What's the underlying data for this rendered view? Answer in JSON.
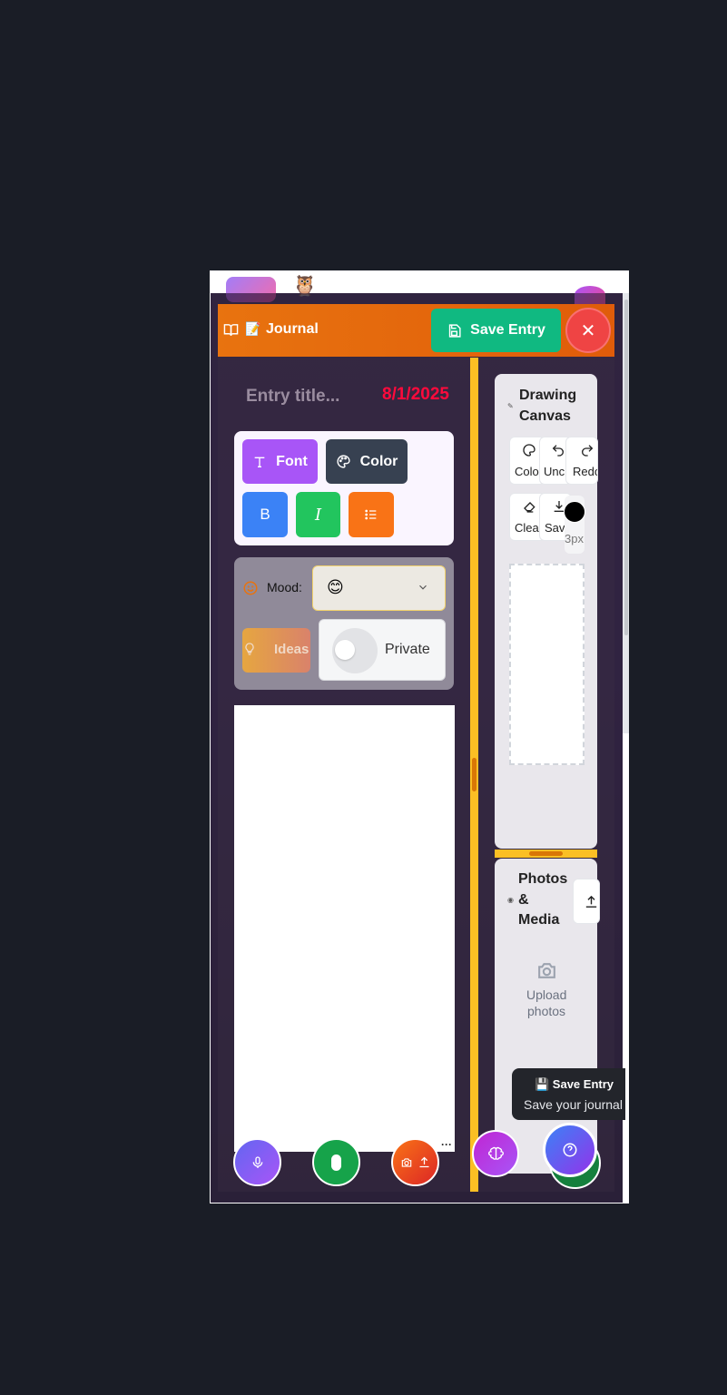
{
  "header": {
    "title": "Journal",
    "save_label": "Save Entry",
    "close_symbol": "✕",
    "colors": {
      "start": "#e8730f",
      "end": "#e05c0a"
    }
  },
  "entry": {
    "title_placeholder": "Entry title...",
    "date": "8/1/2025"
  },
  "toolbar": {
    "font_label": "Font",
    "color_label": "Color",
    "bold_icon": "B",
    "italic_icon": "I"
  },
  "mood": {
    "label": "Mood:",
    "selected": "😊"
  },
  "ideas": {
    "label": "Ideas"
  },
  "privacy": {
    "label": "Private",
    "enabled": false
  },
  "drawing": {
    "title_line1": "Drawing",
    "title_line2": "Canvas",
    "tools": [
      {
        "label": "Colo",
        "icon": "palette-icon"
      },
      {
        "label": "Unc",
        "icon": "undo-icon"
      },
      {
        "label": "Redo",
        "icon": "redo-icon"
      },
      {
        "label": "Clea",
        "icon": "eraser-icon"
      },
      {
        "label": "Sav",
        "icon": "download-icon"
      }
    ],
    "brush_size": "3px"
  },
  "photos": {
    "title_line1": "Photos",
    "title_line2": "&",
    "title_line3": "Media",
    "upload_line1": "Upload",
    "upload_line2": "photos"
  },
  "tooltip": {
    "title": "💾 Save Entry",
    "subtitle": "Save your journal"
  },
  "more_dots": "···",
  "app": {
    "owl_emoji": "🦉"
  }
}
